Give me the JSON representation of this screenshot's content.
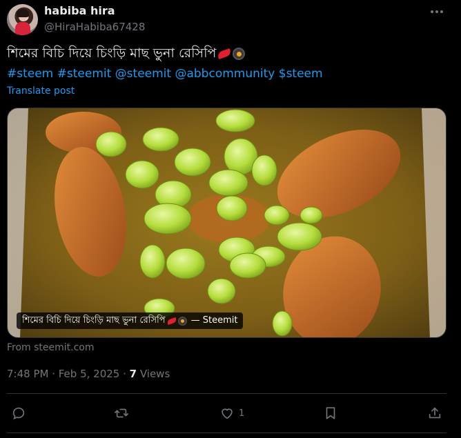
{
  "author": {
    "name": "habiba hira",
    "handle": "@HiraHabiba67428"
  },
  "post": {
    "text": "শিমের বিচি দিয়ে চিংড়ি মাছ ভুনা রেসিপি",
    "tags": "#steem #steemit @steemit @abbcommunity $steem",
    "translate": "Translate post",
    "media_caption": "শিমের বিচি দিয়ে চিংড়ি মাছ ভুনা রেসিপি",
    "media_source": "— Steemit",
    "from": "From steemit.com",
    "time": "7:48 PM · Feb 5, 2025 · ",
    "views_count": "7",
    "views_label": " Views"
  },
  "actions": {
    "reply_count": "",
    "repost_count": "",
    "like_count": "1"
  },
  "icons": [
    "more-icon",
    "chili-emoji",
    "pan-emoji",
    "reply-icon",
    "repost-icon",
    "like-icon",
    "bookmark-icon",
    "share-icon"
  ],
  "colors": {
    "link": "#1d9bf0",
    "muted": "#71767b",
    "text": "#e7e9ea",
    "background": "#000000"
  }
}
